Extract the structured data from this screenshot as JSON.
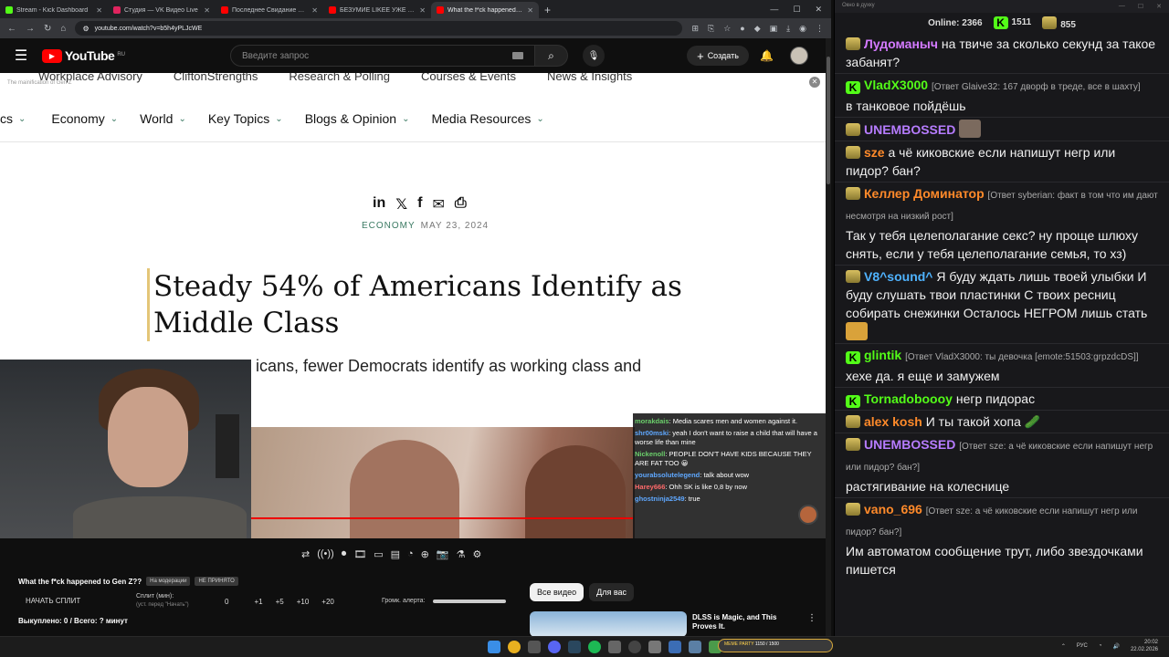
{
  "browser": {
    "tabs": [
      {
        "title": "Stream - Kick Dashboard",
        "color": "#53fc18",
        "active": false
      },
      {
        "title": "Студия — VK Видео Live",
        "color": "#e0245e",
        "active": false
      },
      {
        "title": "Последнее Свидание Яйцесл...",
        "color": "#ff0000",
        "active": false
      },
      {
        "title": "БЕЗУМИЕ LIKEE УЖЕ НЕ ОСТА...",
        "color": "#ff0000",
        "active": false
      },
      {
        "title": "What the f*ck happened to G...",
        "color": "#ff0000",
        "active": true
      }
    ],
    "url": "youtube.com/watch?v=b5h4yPLJcWE"
  },
  "youtube": {
    "logo_text": "YouTube",
    "logo_region": "RU",
    "search_placeholder": "Введите запрос",
    "create_label": "Создать"
  },
  "article": {
    "top_nav": [
      "Workplace Advisory",
      "CliftonStrengths",
      "Research & Polling",
      "Courses & Events",
      "News & Insights"
    ],
    "ghost_text": "The mainification of Gen Z",
    "nav": [
      "cs",
      "Economy",
      "World",
      "Key Topics",
      "Blogs & Opinion",
      "Media Resources"
    ],
    "category": "ECONOMY",
    "date": "MAY 23, 2024",
    "headline": "Steady 54% of Americans Identify as Middle Class",
    "subtitle": "icans, fewer Democrats identify as working class and"
  },
  "overlay_chat": [
    {
      "user": "morakdais",
      "color": "#6bcf6b",
      "text": "Media scares men and women against it."
    },
    {
      "user": "shr00mski",
      "color": "#5fa8ff",
      "text": "yeah I don't want to raise a child that will have a worse life than mine"
    },
    {
      "user": "Nickenoll",
      "color": "#6bcf6b",
      "text": "PEOPLE DON'T HAVE KIDS BECAUSE THEY ARE FAT TOO"
    },
    {
      "user": "yourabsolutelegend",
      "color": "#5fa8ff",
      "text": "talk about wow"
    },
    {
      "user": "Harey666",
      "color": "#ff6a6a",
      "text": "Ohh SK is like 0,8 by now"
    },
    {
      "user": "ghostninja2549",
      "color": "#5fa8ff",
      "text": "true"
    }
  ],
  "controls": {
    "video_title": "What the f*ck happened to Gen Z??",
    "pill1": "На модерации",
    "pill2": "НЕ ПРИНЯТО",
    "start_split": "НАЧАТЬ СПЛИТ",
    "split_label": "Сплит (мин):",
    "split_hint": "(уст. перед \"Начать\")",
    "split_value": "0",
    "increments": [
      "+1",
      "+5",
      "+10",
      "+20"
    ],
    "volume_label": "Громк. алерта:",
    "bought": "Выкуплено: 0 / Всего: ? минут",
    "chips": [
      "Все видео",
      "Для вас"
    ],
    "rec_title": "DLSS is Magic, and This Proves It."
  },
  "chat_panel": {
    "window_title": "Окно в духку",
    "online_label": "Online:",
    "online_count": "2366",
    "kick_count": "1511",
    "other_count": "855",
    "messages": [
      {
        "badge": "crown",
        "user": "Лудоманыч",
        "color": "#d47aff",
        "reply": "",
        "text": "на твиче за сколько секунд за такое забанят?"
      },
      {
        "badge": "k",
        "user": "VladX3000",
        "color": "#53fc18",
        "reply": "[Ответ Glaive32: 167 дворф в треде, все в шахту]",
        "text": "в танковое пойдёшь"
      },
      {
        "badge": "crown",
        "user": "UNEMBOSSED",
        "color": "#b67cff",
        "reply": "",
        "text": ""
      },
      {
        "badge": "crown",
        "user": "sze",
        "color": "#ff8a2a",
        "reply": "",
        "text": "а чё киковские если напишут негр или пидор? бан?"
      },
      {
        "badge": "crown",
        "user": "Келлер Доминатор",
        "color": "#ff8a2a",
        "reply": "[Ответ syberian: факт в том что им дают несмотря на низкий рост]",
        "text": "Так у тебя целеполагание секс? ну проще шлюху снять, если у тебя целеполагание семья, то хз)"
      },
      {
        "badge": "crown",
        "user": "V8^sound^",
        "color": "#4fb3ff",
        "reply": "",
        "text": "Я буду ждать лишь твоей улыбки И буду слушать твои пластинки С твоих ресниц собирать снежинки Осталось НЕГРОМ лишь стать"
      },
      {
        "badge": "k",
        "user": "glintik",
        "color": "#53fc18",
        "reply": "[Ответ VladX3000: ты девочка [emote:51503:grpzdcDS]]",
        "text": "хехе да. я еще и замужем"
      },
      {
        "badge": "k",
        "user": "Tornadobooоy",
        "color": "#53fc18",
        "reply": "",
        "text": "негр пидорас"
      },
      {
        "badge": "crown",
        "user": "alex kosh",
        "color": "#ff8a2a",
        "reply": "",
        "text": "И ты такой хопа"
      },
      {
        "badge": "crown",
        "user": "UNEMBOSSED",
        "color": "#b67cff",
        "reply": "[Ответ sze: а чё киковские если напишут негр или пидор? бан?]",
        "text": "растягивание на колеснице"
      },
      {
        "badge": "crown",
        "user": "vano_696",
        "color": "#ff8a2a",
        "reply": "[Ответ sze: а чё киковские если напишут негр или пидор? бан?]",
        "text": "Им автоматом сообщение трут, либо звездочками пишется"
      }
    ]
  },
  "taskbar": {
    "lang": "РУС",
    "time": "20:02",
    "date": "22.02.2026",
    "meme_label": "MEME PARTY",
    "meme_counter": "1150 / 1500"
  }
}
